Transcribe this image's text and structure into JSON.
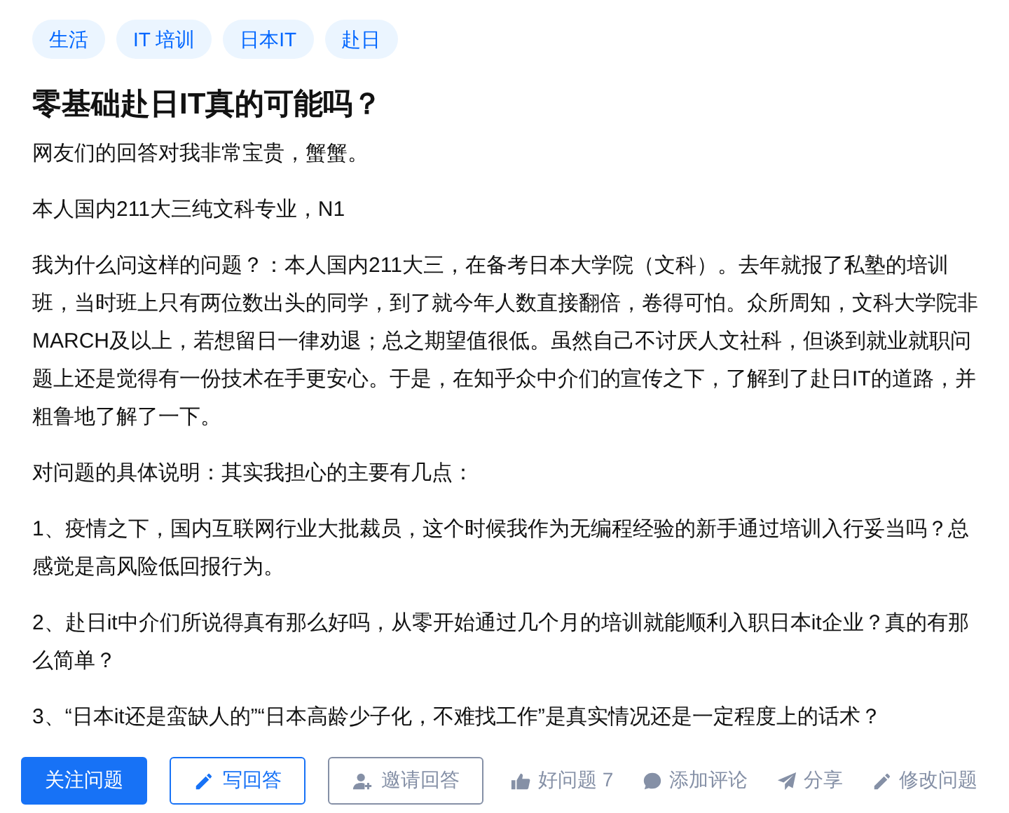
{
  "tags": [
    "生活",
    "IT 培训",
    "日本IT",
    "赴日"
  ],
  "title": "零基础赴日IT真的可能吗？",
  "paragraphs": [
    "网友们的回答对我非常宝贵，蟹蟹。",
    "本人国内211大三纯文科专业，N1",
    "我为什么问这样的问题？：本人国内211大三，在备考日本大学院（文科）。去年就报了私塾的培训班，当时班上只有两位数出头的同学，到了就今年人数直接翻倍，卷得可怕。众所周知，文科大学院非MARCH及以上，若想留日一律劝退；总之期望值很低。虽然自己不讨厌人文社科，但谈到就业就职问题上还是觉得有一份技术在手更安心。于是，在知乎众中介们的宣传之下，了解到了赴日IT的道路，并粗鲁地了解了一下。",
    "对问题的具体说明：其实我担心的主要有几点：",
    "1、疫情之下，国内互联网行业大批裁员，这个时候我作为无编程经验的新手通过培训入行妥当吗？总感觉是高风险低回报行为。",
    "2、赴日it中介们所说得真有那么好吗，从零开始通过几个月的培训就能顺利入职日本it企业？真的有那么简单？",
    "3、“日本it还是蛮缺人的”“日本高龄少子化，不难找工作”是真实情况还是一定程度上的话术？"
  ],
  "actions": [
    {
      "kind": "primary",
      "label": "关注问题"
    },
    {
      "kind": "outline",
      "label": "写回答"
    },
    {
      "kind": "muted",
      "label": "邀请回答"
    },
    {
      "kind": "text",
      "label": "好问题 7"
    },
    {
      "kind": "text",
      "label": "添加评论"
    },
    {
      "kind": "text",
      "label": "分享"
    },
    {
      "kind": "text",
      "label": "修改问题"
    }
  ]
}
